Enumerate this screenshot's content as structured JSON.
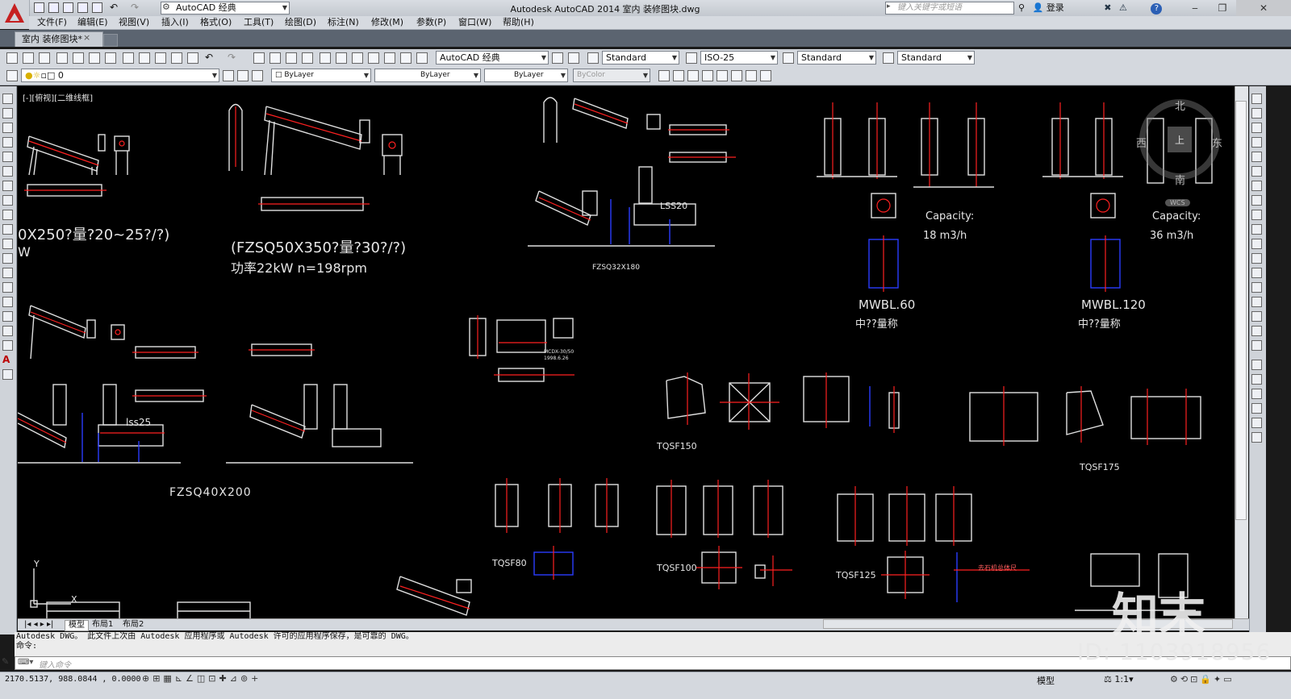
{
  "titlebar": {
    "workspace": "AutoCAD 经典",
    "title": "Autodesk AutoCAD 2014    室内 装修图块.dwg",
    "search_placeholder": "键入关键字或短语",
    "login": "登录",
    "help": "?"
  },
  "menu": [
    "文件(F)",
    "编辑(E)",
    "视图(V)",
    "插入(I)",
    "格式(O)",
    "工具(T)",
    "绘图(D)",
    "标注(N)",
    "修改(M)",
    "参数(P)",
    "窗口(W)",
    "帮助(H)"
  ],
  "tab": {
    "name": "室内 装修图块*",
    "close": "×"
  },
  "toolbar1": {
    "workspace": "AutoCAD 经典",
    "text_style": "Standard",
    "dim_style": "ISO-25",
    "table_style": "Standard",
    "mleader_style": "Standard"
  },
  "toolbar2": {
    "layer": "0",
    "color": "ByLayer",
    "linetype": "ByLayer",
    "lineweight": "ByLayer",
    "plotstyle": "ByColor"
  },
  "viewport": {
    "label": "[-][俯视][二维线框]"
  },
  "cad_text": {
    "t1": "0X250?量?20~25?/?)",
    "t2": "W",
    "t3": "(FZSQ50X350?量?30?/?)",
    "t4": "功率22kW   n=198rpm",
    "t5": "FZSQ32X180",
    "t6": "LSS20",
    "t7": "Capacity:",
    "t8": "18 m3/h",
    "t9": "Capacity:",
    "t10": "36 m3/h",
    "t11": "MWBL.60",
    "t12": "中??量称",
    "t13": "MWBL.120",
    "t14": "中??量称",
    "t15": "lss25",
    "t16": "FZSQ40X200",
    "t17": "TQSF150",
    "t18": "TQSF175",
    "t19": "TQSF80",
    "t20": "TQSF100",
    "t21": "TQSF125",
    "t22": "MCDX-30/50\n1998.6.26",
    "t23": "去石机总体尺"
  },
  "viewcube": {
    "n": "北",
    "s": "南",
    "e": "东",
    "w": "西",
    "top": "上",
    "wcs": "WCS"
  },
  "ucs": {
    "y": "Y",
    "x": "X"
  },
  "layout_tabs": [
    "模型",
    "布局1",
    "布局2"
  ],
  "command": {
    "line1": "Autodesk DWG。  此文件上次由 Autodesk 应用程序或 Autodesk 许可的应用程序保存，是可靠的 DWG。",
    "line2": "命令:",
    "placeholder": "键入命令"
  },
  "status": {
    "coords": "2170.5137, 988.0844  , 0.0000",
    "model": "模型",
    "scale": "1:1"
  },
  "watermark": {
    "id": "ID: 1103918956",
    "logo": "知末"
  }
}
